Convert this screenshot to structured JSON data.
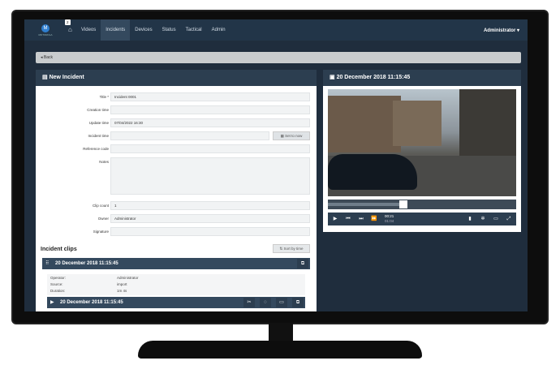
{
  "topbar": {
    "brand": "MOTOROLA",
    "home_badge": "2",
    "nav": [
      "Videos",
      "Incidents",
      "Devices",
      "Status",
      "Tactical",
      "Admin"
    ],
    "active": "Incidents",
    "user": "Administrator"
  },
  "back_label": "Back",
  "incident": {
    "header": "New Incident",
    "fields": [
      {
        "label": "Title *",
        "value": "Incident 0001"
      },
      {
        "label": "Creation time",
        "value": ""
      },
      {
        "label": "Update time",
        "value": "07/04/2022 16:30"
      },
      {
        "label": "Incident time",
        "value": ""
      },
      {
        "label": "Reference code",
        "value": ""
      },
      {
        "label": "Notes",
        "value": ""
      },
      {
        "label": "Clip count",
        "value": "1"
      },
      {
        "label": "Owner",
        "value": "Administrator"
      },
      {
        "label": "Signature",
        "value": ""
      }
    ],
    "set_now_label": "Set to now"
  },
  "clips": {
    "header": "Incident clips",
    "sort_label": "Sort by time",
    "clip1_title": "20 December 2018 11:15:45",
    "details": [
      {
        "k": "Operator:",
        "v": "Administrator"
      },
      {
        "k": "Source:",
        "v": "import"
      },
      {
        "k": "Duration:",
        "v": "1m 4s"
      }
    ],
    "clip2_title": "20 December 2018 11:15:45"
  },
  "player": {
    "header": "20 December 2018 11:15:45",
    "progress": 0.4,
    "time_current": "00:21",
    "time_total": "01:04"
  }
}
